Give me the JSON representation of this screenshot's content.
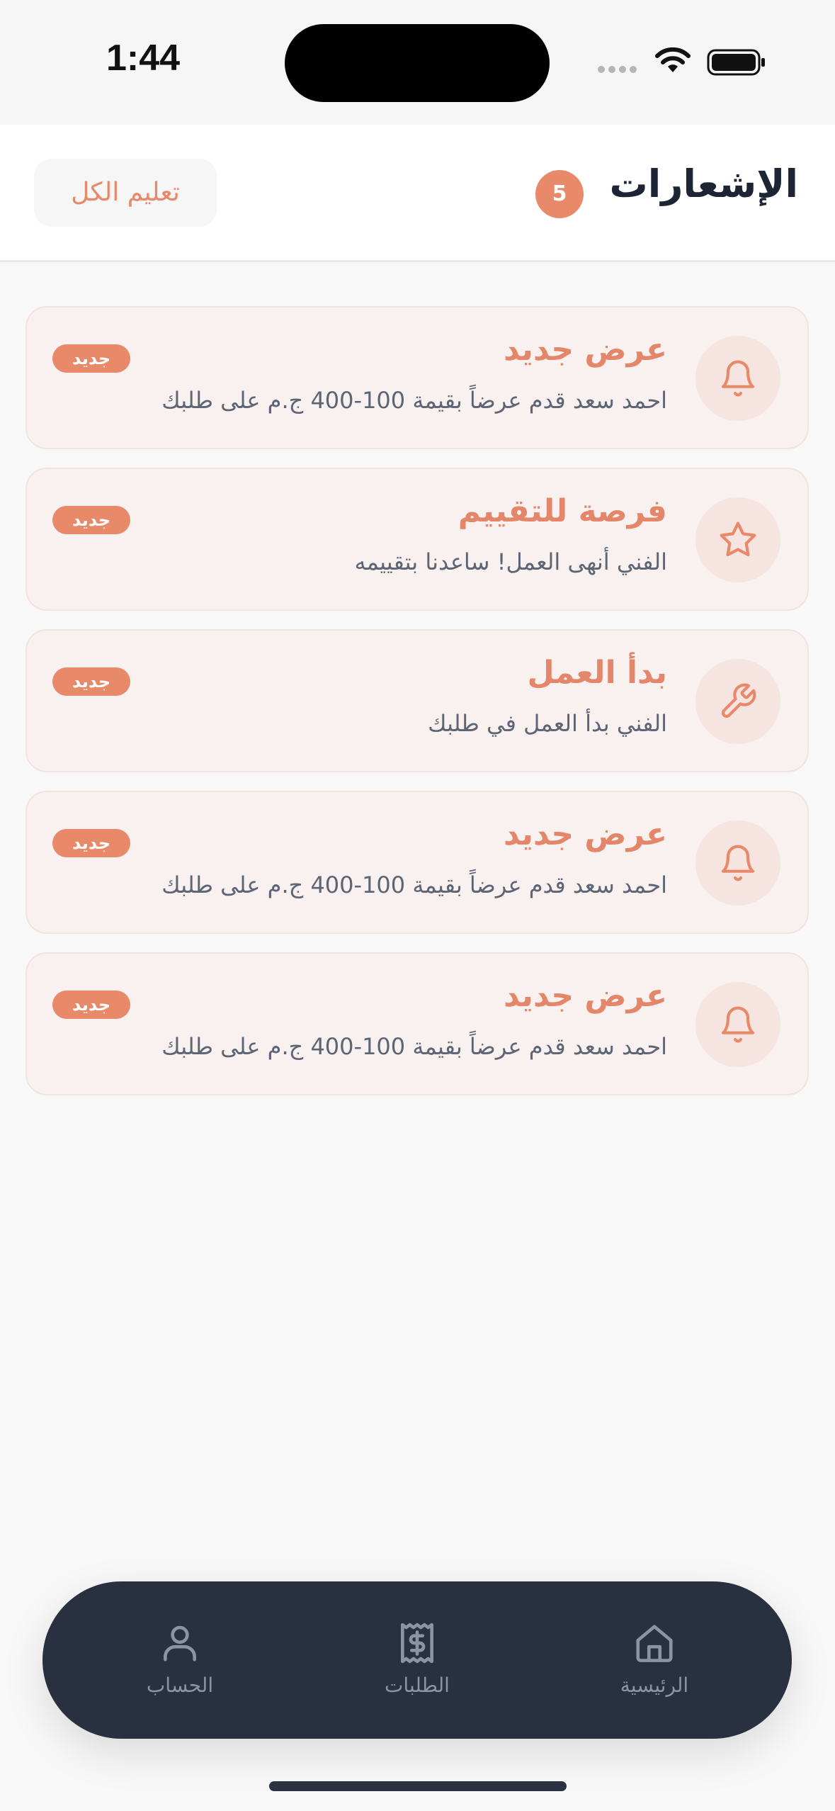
{
  "status_bar": {
    "time": "1:44"
  },
  "header": {
    "title": "الإشعارات",
    "count": "5",
    "mark_all_label": "تعليم الكل"
  },
  "notifications": [
    {
      "icon": "bell-icon",
      "title": "عرض جديد",
      "body": "احمد سعد قدم عرضاً بقيمة 100-400 ج.م على طلبك",
      "badge": "جديد"
    },
    {
      "icon": "star-icon",
      "title": "فرصة للتقييم",
      "body": "الفني أنهى العمل! ساعدنا بتقييمه",
      "badge": "جديد"
    },
    {
      "icon": "wrench-icon",
      "title": "بدأ العمل",
      "body": "الفني بدأ العمل في طلبك",
      "badge": "جديد"
    },
    {
      "icon": "bell-icon",
      "title": "عرض جديد",
      "body": "احمد سعد قدم عرضاً بقيمة 100-400 ج.م على طلبك",
      "badge": "جديد"
    },
    {
      "icon": "bell-icon",
      "title": "عرض جديد",
      "body": "احمد سعد قدم عرضاً بقيمة 100-400 ج.م على طلبك",
      "badge": "جديد"
    }
  ],
  "bottom_nav": {
    "account_label": "الحساب",
    "orders_label": "الطلبات",
    "home_label": "الرئيسية"
  },
  "colors": {
    "accent": "#e8896a",
    "nav_background": "#293140",
    "card_background": "#f8f1f0"
  }
}
